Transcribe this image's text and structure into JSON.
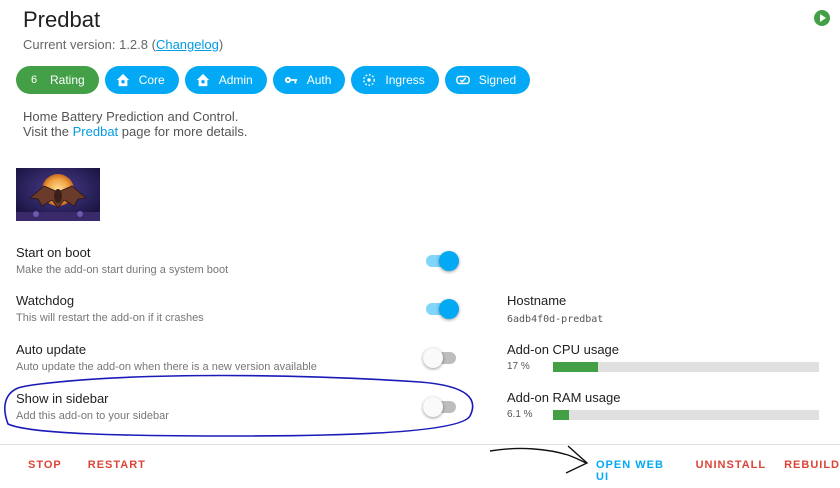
{
  "header": {
    "title": "Predbat",
    "version_prefix": "Current version: 1.2.8 (",
    "changelog_link": "Changelog",
    "version_suffix": ")"
  },
  "chips": [
    {
      "icon_name": "rating-icon",
      "icon_text": "6",
      "label": "Rating",
      "color": "#43a047"
    },
    {
      "icon_name": "home-assistant-icon",
      "label": "Core",
      "color": "#03a9f4"
    },
    {
      "icon_name": "home-assistant-icon",
      "label": "Admin",
      "color": "#03a9f4"
    },
    {
      "icon_name": "key-icon",
      "label": "Auth",
      "color": "#03a9f4"
    },
    {
      "icon_name": "ingress-icon",
      "label": "Ingress",
      "color": "#03a9f4"
    },
    {
      "icon_name": "signed-icon",
      "label": "Signed",
      "color": "#03a9f4"
    }
  ],
  "description": {
    "line1": "Home Battery Prediction and Control.",
    "line2_prefix": "Visit the ",
    "line2_link": "Predbat",
    "line2_suffix": " page for more details."
  },
  "options": {
    "start_on_boot": {
      "title": "Start on boot",
      "subtitle": "Make the add-on start during a system boot",
      "enabled": true
    },
    "watchdog": {
      "title": "Watchdog",
      "subtitle": "This will restart the add-on if it crashes",
      "enabled": true
    },
    "auto_update": {
      "title": "Auto update",
      "subtitle": "Auto update the add-on when there is a new version available",
      "enabled": false
    },
    "show_in_sidebar": {
      "title": "Show in sidebar",
      "subtitle": "Add this add-on to your sidebar",
      "enabled": false
    }
  },
  "info": {
    "hostname_label": "Hostname",
    "hostname_value": "6adb4f0d-predbat",
    "cpu_label": "Add-on CPU usage",
    "cpu_value": "17 %",
    "cpu_percent": 17,
    "ram_label": "Add-on RAM usage",
    "ram_value": "6.1 %",
    "ram_percent": 6.1
  },
  "actions": {
    "stop": "STOP",
    "restart": "RESTART",
    "open_web_ui": "OPEN WEB UI",
    "uninstall": "UNINSTALL",
    "rebuild": "REBUILD"
  },
  "colors": {
    "accent": "#03a9f4",
    "success": "#43a047",
    "danger": "#db4437",
    "annotation": "#1a1ab8"
  }
}
